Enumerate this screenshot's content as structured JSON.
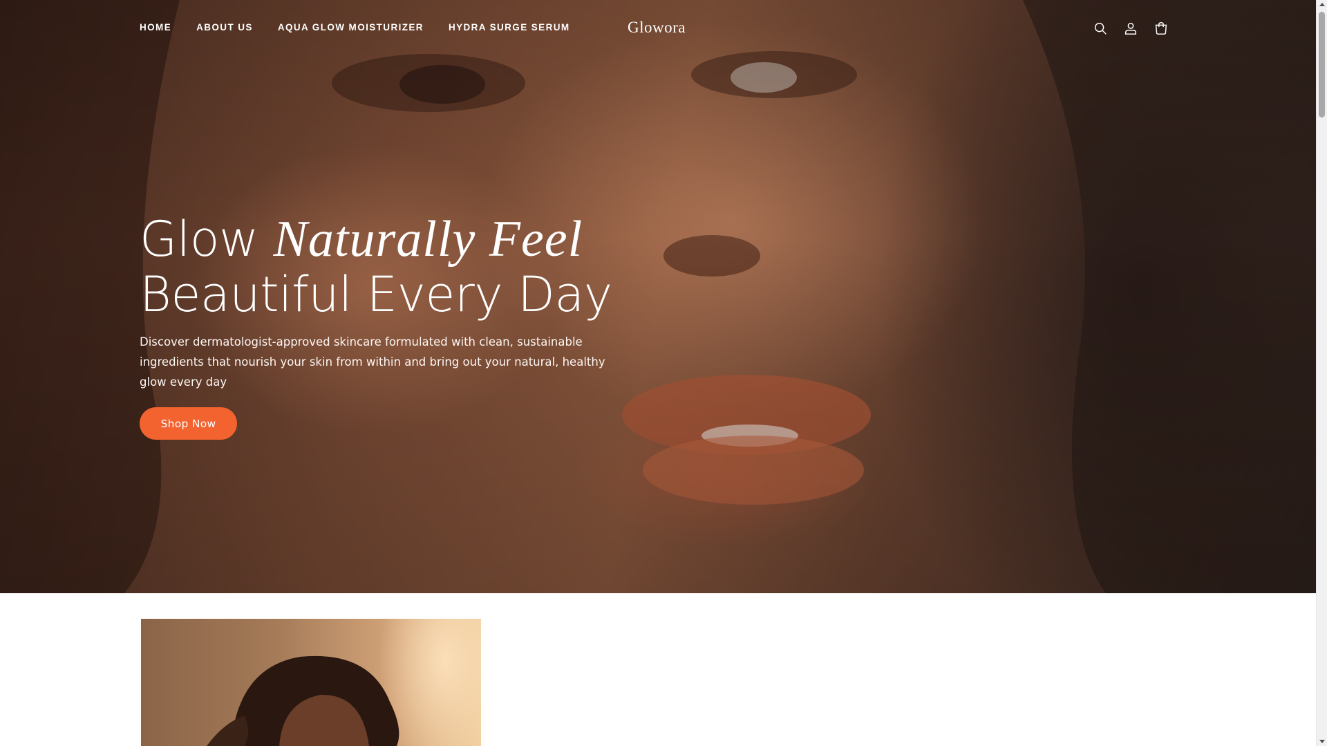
{
  "header": {
    "nav": [
      {
        "label": "HOME"
      },
      {
        "label": "ABOUT US"
      },
      {
        "label": "AQUA GLOW MOISTURIZER"
      },
      {
        "label": "HYDRA SURGE SERUM"
      }
    ],
    "logo": "Glowora",
    "icons": [
      "search-icon",
      "account-icon",
      "cart-icon"
    ]
  },
  "hero": {
    "headline_word1": "Glow",
    "headline_italic": "Naturally Feel",
    "headline_line2": "Beautiful Every Day",
    "description": "Discover dermatologist-approved skincare formulated with clean, sustainable ingredients that nourish your skin from within and bring out your natural, healthy glow every day",
    "cta_label": "Shop Now"
  },
  "colors": {
    "accent": "#f26330",
    "text_on_hero": "#ffffff",
    "page_background": "#ffffff"
  }
}
